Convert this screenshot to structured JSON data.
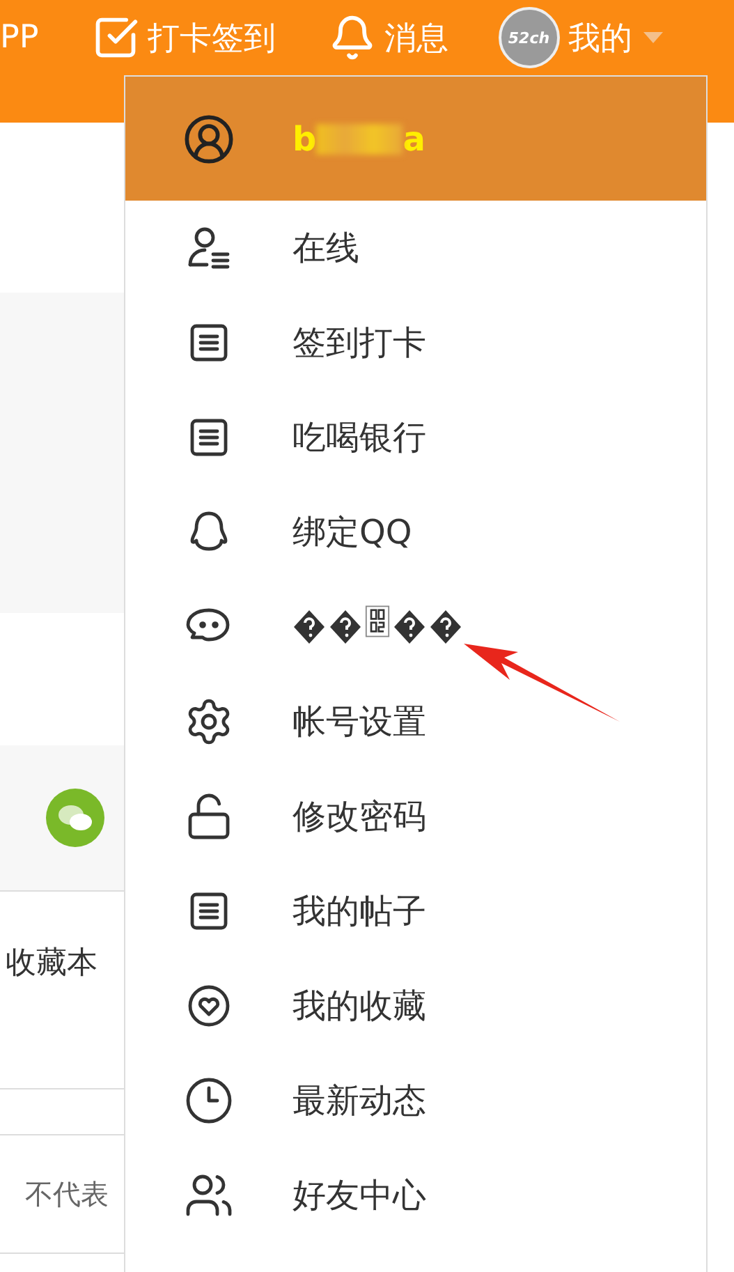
{
  "top_bar": {
    "items": [
      {
        "kind": "text",
        "label": "PP"
      },
      {
        "kind": "checkin",
        "label": "打卡签到"
      },
      {
        "kind": "bell",
        "label": "消息"
      },
      {
        "kind": "avatar",
        "label": "我的",
        "avatar_text": "52ch"
      }
    ]
  },
  "background_page": {
    "favorites_text": "收藏本",
    "disclaimer_text": "不代表"
  },
  "user_menu": {
    "header": {
      "name_start": "b",
      "name_end": "a"
    },
    "items": [
      {
        "kind": "online",
        "label": "在线"
      },
      {
        "kind": "list",
        "label": "签到打卡"
      },
      {
        "kind": "list",
        "label": "吃喝银行"
      },
      {
        "kind": "qq",
        "label": "绑定QQ"
      },
      {
        "kind": "chat",
        "garbled": true
      },
      {
        "kind": "gear",
        "label": "帐号设置"
      },
      {
        "kind": "lock",
        "label": "修改密码"
      },
      {
        "kind": "list",
        "label": "我的帖子"
      },
      {
        "kind": "heart",
        "label": "我的收藏"
      },
      {
        "kind": "clock",
        "label": "最新动态"
      },
      {
        "kind": "friends",
        "label": "好友中心"
      }
    ]
  }
}
